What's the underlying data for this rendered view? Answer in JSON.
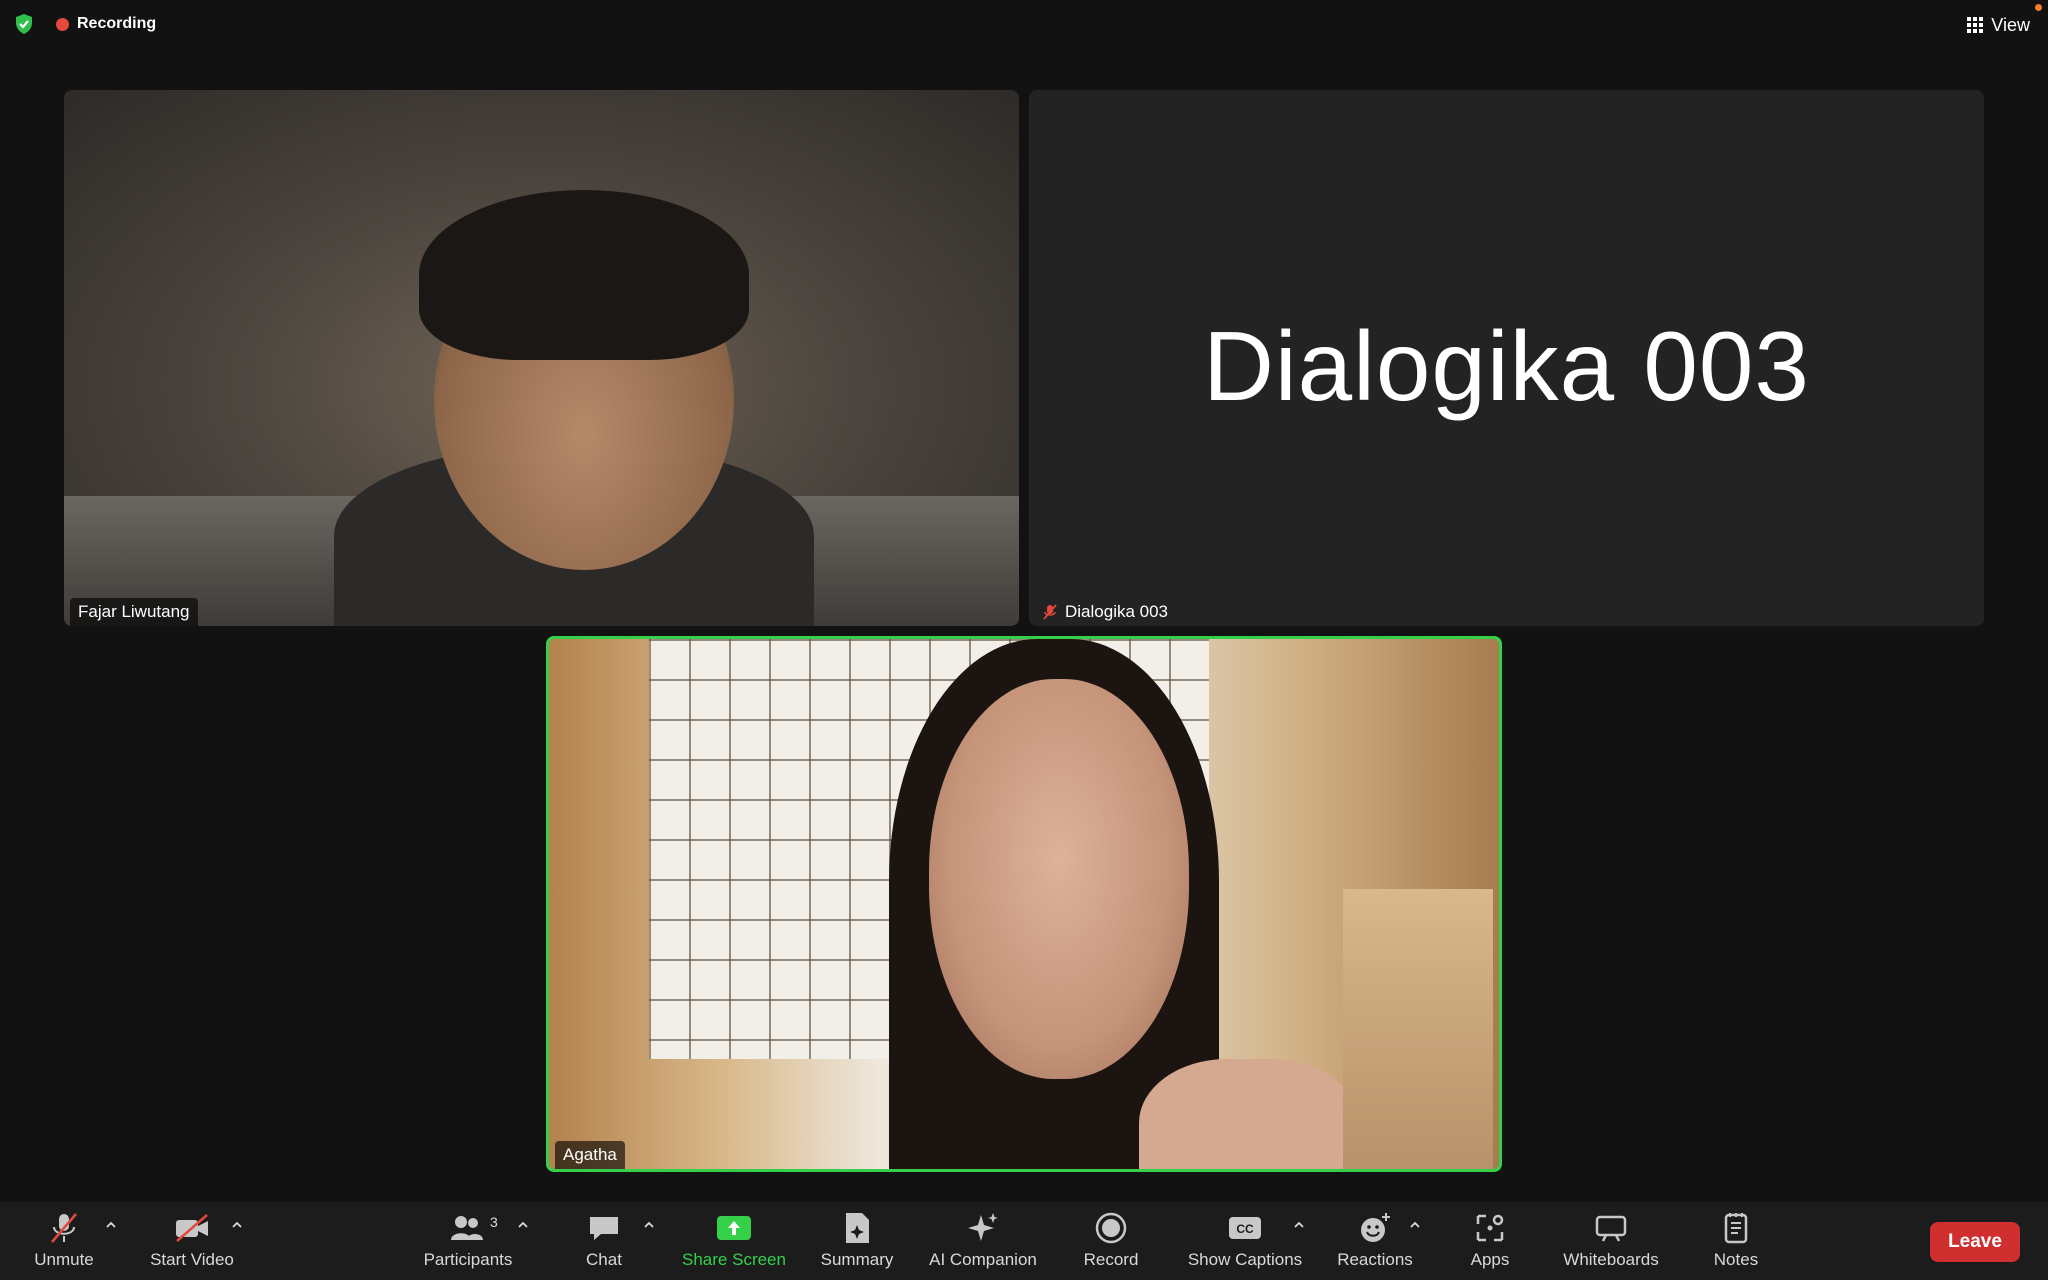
{
  "top_bar": {
    "recording_label": "Recording",
    "view_label": "View"
  },
  "participants": {
    "tile1_name": "Fajar Liwutang",
    "tile2_name": "Dialogika 003",
    "tile2_display_name": "Dialogika 003",
    "tile3_name": "Agatha"
  },
  "toolbar": {
    "unmute_label": "Unmute",
    "start_video_label": "Start Video",
    "participants_label": "Participants",
    "participants_count": "3",
    "chat_label": "Chat",
    "share_screen_label": "Share Screen",
    "summary_label": "Summary",
    "ai_companion_label": "AI Companion",
    "record_label": "Record",
    "show_captions_label": "Show Captions",
    "reactions_label": "Reactions",
    "apps_label": "Apps",
    "whiteboards_label": "Whiteboards",
    "notes_label": "Notes",
    "leave_label": "Leave"
  },
  "colors": {
    "active_speaker_border": "#35d04a",
    "leave_button": "#cf2f2f",
    "recording_dot": "#e5483f",
    "share_screen": "#35d04a"
  }
}
